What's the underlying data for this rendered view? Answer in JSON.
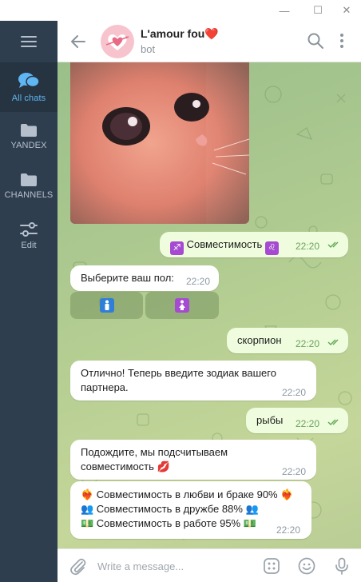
{
  "window": {
    "minimize": "—",
    "maximize": "☐",
    "close": "✕"
  },
  "sidebar": {
    "items": [
      {
        "label": "All chats",
        "icon": "chat-bubbles-icon",
        "active": true
      },
      {
        "label": "YANDEX",
        "icon": "folder-icon"
      },
      {
        "label": "CHANNELS",
        "icon": "folder-icon"
      },
      {
        "label": "Edit",
        "icon": "sliders-icon"
      }
    ]
  },
  "header": {
    "title": "L'amour fou❤️",
    "subtitle": "bot"
  },
  "messages": [
    {
      "id": "m1",
      "dir": "out",
      "zodiac_left": "♐",
      "text": "Совместимость",
      "zodiac_right": "♌",
      "time": "22:20",
      "read": true
    },
    {
      "id": "m2",
      "dir": "in",
      "text": "Выберите ваш пол:",
      "time": "22:20"
    },
    {
      "id": "m3",
      "dir": "out",
      "text": "скорпион",
      "time": "22:20",
      "read": true
    },
    {
      "id": "m4",
      "dir": "in",
      "text_line1": "Отлично! Теперь введите зодиак вашего",
      "text_line2": "партнера.",
      "time": "22:20"
    },
    {
      "id": "m5",
      "dir": "out",
      "text": "рыбы",
      "time": "22:20",
      "read": true
    },
    {
      "id": "m6",
      "dir": "in",
      "text_line1": "Подождите, мы подсчитываем",
      "text_line2": "совместимость 💋",
      "time": "22:20"
    },
    {
      "id": "m7",
      "dir": "in",
      "line1": "❤️‍🔥 Совместимость в любви и браке 90% ❤️‍🔥",
      "line2": "👥 Совместимость в дружбе 88% 👥",
      "line3": "💵 Совместимость в работе 95% 💵",
      "time": "22:20"
    }
  ],
  "keyboard": {
    "buttons": [
      {
        "symbol": "🚹",
        "color": "#2f7fd8"
      },
      {
        "symbol": "🚺",
        "color": "#a64bd1"
      }
    ]
  },
  "composer": {
    "placeholder": "Write a message..."
  },
  "colors": {
    "accent": "#5fb6f2",
    "sidebar_bg": "#2f3e4e",
    "out_bubble": "#effdde",
    "in_bubble": "#ffffff",
    "read_check": "#5ca853"
  }
}
